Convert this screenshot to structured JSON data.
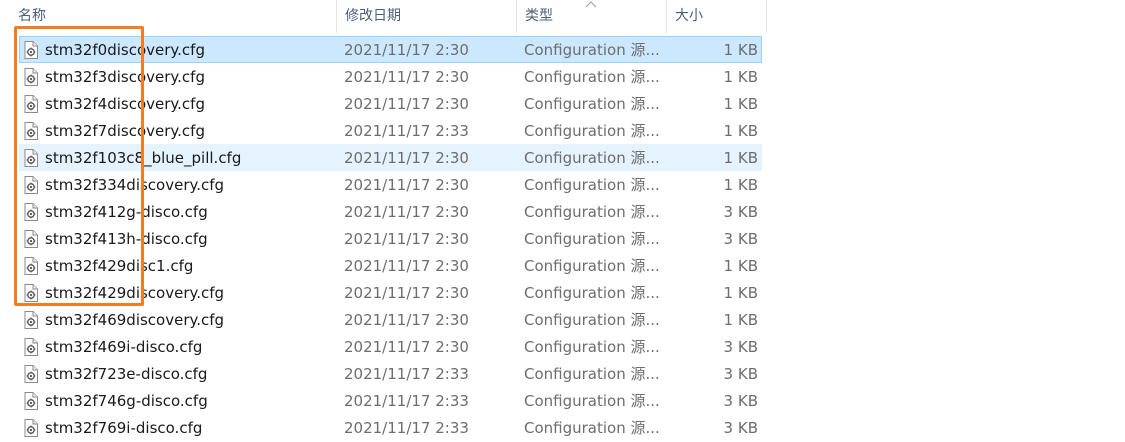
{
  "header": {
    "name": "名称",
    "date": "修改日期",
    "type": "类型",
    "size": "大小"
  },
  "sort_indicator": "sort-ascending-chevron-icon",
  "colors": {
    "selected_bg": "#cce8ff",
    "hover_bg": "#e5f3ff",
    "annotation_box": "#f37c22"
  },
  "files": [
    {
      "name": "stm32f0discovery.cfg",
      "date": "2021/11/17 2:30",
      "type": "Configuration 源...",
      "size": "1 KB",
      "state": "selected"
    },
    {
      "name": "stm32f3discovery.cfg",
      "date": "2021/11/17 2:30",
      "type": "Configuration 源...",
      "size": "1 KB",
      "state": ""
    },
    {
      "name": "stm32f4discovery.cfg",
      "date": "2021/11/17 2:30",
      "type": "Configuration 源...",
      "size": "1 KB",
      "state": ""
    },
    {
      "name": "stm32f7discovery.cfg",
      "date": "2021/11/17 2:33",
      "type": "Configuration 源...",
      "size": "1 KB",
      "state": ""
    },
    {
      "name": "stm32f103c8_blue_pill.cfg",
      "date": "2021/11/17 2:30",
      "type": "Configuration 源...",
      "size": "1 KB",
      "state": "hover"
    },
    {
      "name": "stm32f334discovery.cfg",
      "date": "2021/11/17 2:30",
      "type": "Configuration 源...",
      "size": "1 KB",
      "state": ""
    },
    {
      "name": "stm32f412g-disco.cfg",
      "date": "2021/11/17 2:30",
      "type": "Configuration 源...",
      "size": "3 KB",
      "state": ""
    },
    {
      "name": "stm32f413h-disco.cfg",
      "date": "2021/11/17 2:30",
      "type": "Configuration 源...",
      "size": "3 KB",
      "state": ""
    },
    {
      "name": "stm32f429disc1.cfg",
      "date": "2021/11/17 2:30",
      "type": "Configuration 源...",
      "size": "1 KB",
      "state": ""
    },
    {
      "name": "stm32f429discovery.cfg",
      "date": "2021/11/17 2:30",
      "type": "Configuration 源...",
      "size": "1 KB",
      "state": ""
    },
    {
      "name": "stm32f469discovery.cfg",
      "date": "2021/11/17 2:30",
      "type": "Configuration 源...",
      "size": "1 KB",
      "state": ""
    },
    {
      "name": "stm32f469i-disco.cfg",
      "date": "2021/11/17 2:30",
      "type": "Configuration 源...",
      "size": "3 KB",
      "state": ""
    },
    {
      "name": "stm32f723e-disco.cfg",
      "date": "2021/11/17 2:33",
      "type": "Configuration 源...",
      "size": "3 KB",
      "state": ""
    },
    {
      "name": "stm32f746g-disco.cfg",
      "date": "2021/11/17 2:33",
      "type": "Configuration 源...",
      "size": "3 KB",
      "state": ""
    },
    {
      "name": "stm32f769i-disco.cfg",
      "date": "2021/11/17 2:33",
      "type": "Configuration 源...",
      "size": "3 KB",
      "state": ""
    }
  ]
}
